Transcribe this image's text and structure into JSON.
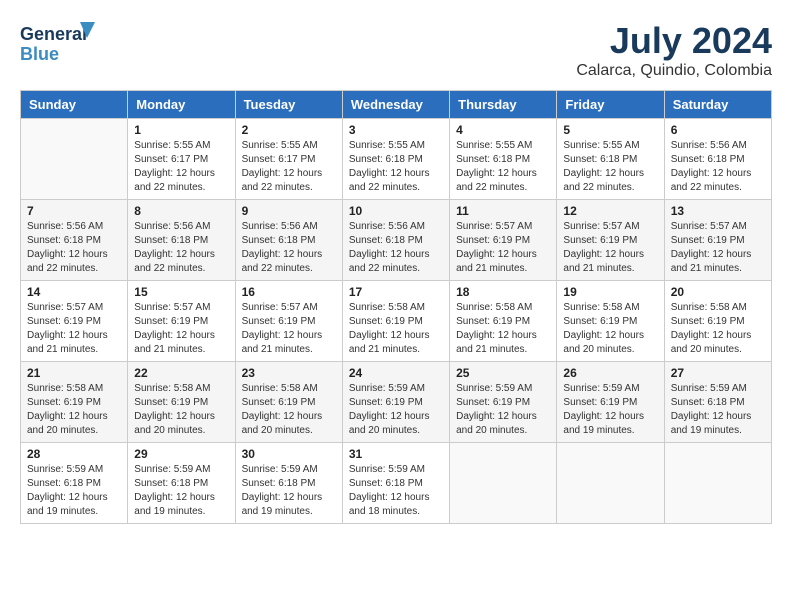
{
  "header": {
    "logo_line1": "General",
    "logo_line2": "Blue",
    "title": "July 2024",
    "subtitle": "Calarca, Quindio, Colombia"
  },
  "weekdays": [
    "Sunday",
    "Monday",
    "Tuesday",
    "Wednesday",
    "Thursday",
    "Friday",
    "Saturday"
  ],
  "weeks": [
    [
      {
        "day": "",
        "info": ""
      },
      {
        "day": "1",
        "info": "Sunrise: 5:55 AM\nSunset: 6:17 PM\nDaylight: 12 hours\nand 22 minutes."
      },
      {
        "day": "2",
        "info": "Sunrise: 5:55 AM\nSunset: 6:17 PM\nDaylight: 12 hours\nand 22 minutes."
      },
      {
        "day": "3",
        "info": "Sunrise: 5:55 AM\nSunset: 6:18 PM\nDaylight: 12 hours\nand 22 minutes."
      },
      {
        "day": "4",
        "info": "Sunrise: 5:55 AM\nSunset: 6:18 PM\nDaylight: 12 hours\nand 22 minutes."
      },
      {
        "day": "5",
        "info": "Sunrise: 5:55 AM\nSunset: 6:18 PM\nDaylight: 12 hours\nand 22 minutes."
      },
      {
        "day": "6",
        "info": "Sunrise: 5:56 AM\nSunset: 6:18 PM\nDaylight: 12 hours\nand 22 minutes."
      }
    ],
    [
      {
        "day": "7",
        "info": "Sunrise: 5:56 AM\nSunset: 6:18 PM\nDaylight: 12 hours\nand 22 minutes."
      },
      {
        "day": "8",
        "info": "Sunrise: 5:56 AM\nSunset: 6:18 PM\nDaylight: 12 hours\nand 22 minutes."
      },
      {
        "day": "9",
        "info": "Sunrise: 5:56 AM\nSunset: 6:18 PM\nDaylight: 12 hours\nand 22 minutes."
      },
      {
        "day": "10",
        "info": "Sunrise: 5:56 AM\nSunset: 6:18 PM\nDaylight: 12 hours\nand 22 minutes."
      },
      {
        "day": "11",
        "info": "Sunrise: 5:57 AM\nSunset: 6:19 PM\nDaylight: 12 hours\nand 21 minutes."
      },
      {
        "day": "12",
        "info": "Sunrise: 5:57 AM\nSunset: 6:19 PM\nDaylight: 12 hours\nand 21 minutes."
      },
      {
        "day": "13",
        "info": "Sunrise: 5:57 AM\nSunset: 6:19 PM\nDaylight: 12 hours\nand 21 minutes."
      }
    ],
    [
      {
        "day": "14",
        "info": "Sunrise: 5:57 AM\nSunset: 6:19 PM\nDaylight: 12 hours\nand 21 minutes."
      },
      {
        "day": "15",
        "info": "Sunrise: 5:57 AM\nSunset: 6:19 PM\nDaylight: 12 hours\nand 21 minutes."
      },
      {
        "day": "16",
        "info": "Sunrise: 5:57 AM\nSunset: 6:19 PM\nDaylight: 12 hours\nand 21 minutes."
      },
      {
        "day": "17",
        "info": "Sunrise: 5:58 AM\nSunset: 6:19 PM\nDaylight: 12 hours\nand 21 minutes."
      },
      {
        "day": "18",
        "info": "Sunrise: 5:58 AM\nSunset: 6:19 PM\nDaylight: 12 hours\nand 21 minutes."
      },
      {
        "day": "19",
        "info": "Sunrise: 5:58 AM\nSunset: 6:19 PM\nDaylight: 12 hours\nand 20 minutes."
      },
      {
        "day": "20",
        "info": "Sunrise: 5:58 AM\nSunset: 6:19 PM\nDaylight: 12 hours\nand 20 minutes."
      }
    ],
    [
      {
        "day": "21",
        "info": "Sunrise: 5:58 AM\nSunset: 6:19 PM\nDaylight: 12 hours\nand 20 minutes."
      },
      {
        "day": "22",
        "info": "Sunrise: 5:58 AM\nSunset: 6:19 PM\nDaylight: 12 hours\nand 20 minutes."
      },
      {
        "day": "23",
        "info": "Sunrise: 5:58 AM\nSunset: 6:19 PM\nDaylight: 12 hours\nand 20 minutes."
      },
      {
        "day": "24",
        "info": "Sunrise: 5:59 AM\nSunset: 6:19 PM\nDaylight: 12 hours\nand 20 minutes."
      },
      {
        "day": "25",
        "info": "Sunrise: 5:59 AM\nSunset: 6:19 PM\nDaylight: 12 hours\nand 20 minutes."
      },
      {
        "day": "26",
        "info": "Sunrise: 5:59 AM\nSunset: 6:19 PM\nDaylight: 12 hours\nand 19 minutes."
      },
      {
        "day": "27",
        "info": "Sunrise: 5:59 AM\nSunset: 6:18 PM\nDaylight: 12 hours\nand 19 minutes."
      }
    ],
    [
      {
        "day": "28",
        "info": "Sunrise: 5:59 AM\nSunset: 6:18 PM\nDaylight: 12 hours\nand 19 minutes."
      },
      {
        "day": "29",
        "info": "Sunrise: 5:59 AM\nSunset: 6:18 PM\nDaylight: 12 hours\nand 19 minutes."
      },
      {
        "day": "30",
        "info": "Sunrise: 5:59 AM\nSunset: 6:18 PM\nDaylight: 12 hours\nand 19 minutes."
      },
      {
        "day": "31",
        "info": "Sunrise: 5:59 AM\nSunset: 6:18 PM\nDaylight: 12 hours\nand 18 minutes."
      },
      {
        "day": "",
        "info": ""
      },
      {
        "day": "",
        "info": ""
      },
      {
        "day": "",
        "info": ""
      }
    ]
  ]
}
